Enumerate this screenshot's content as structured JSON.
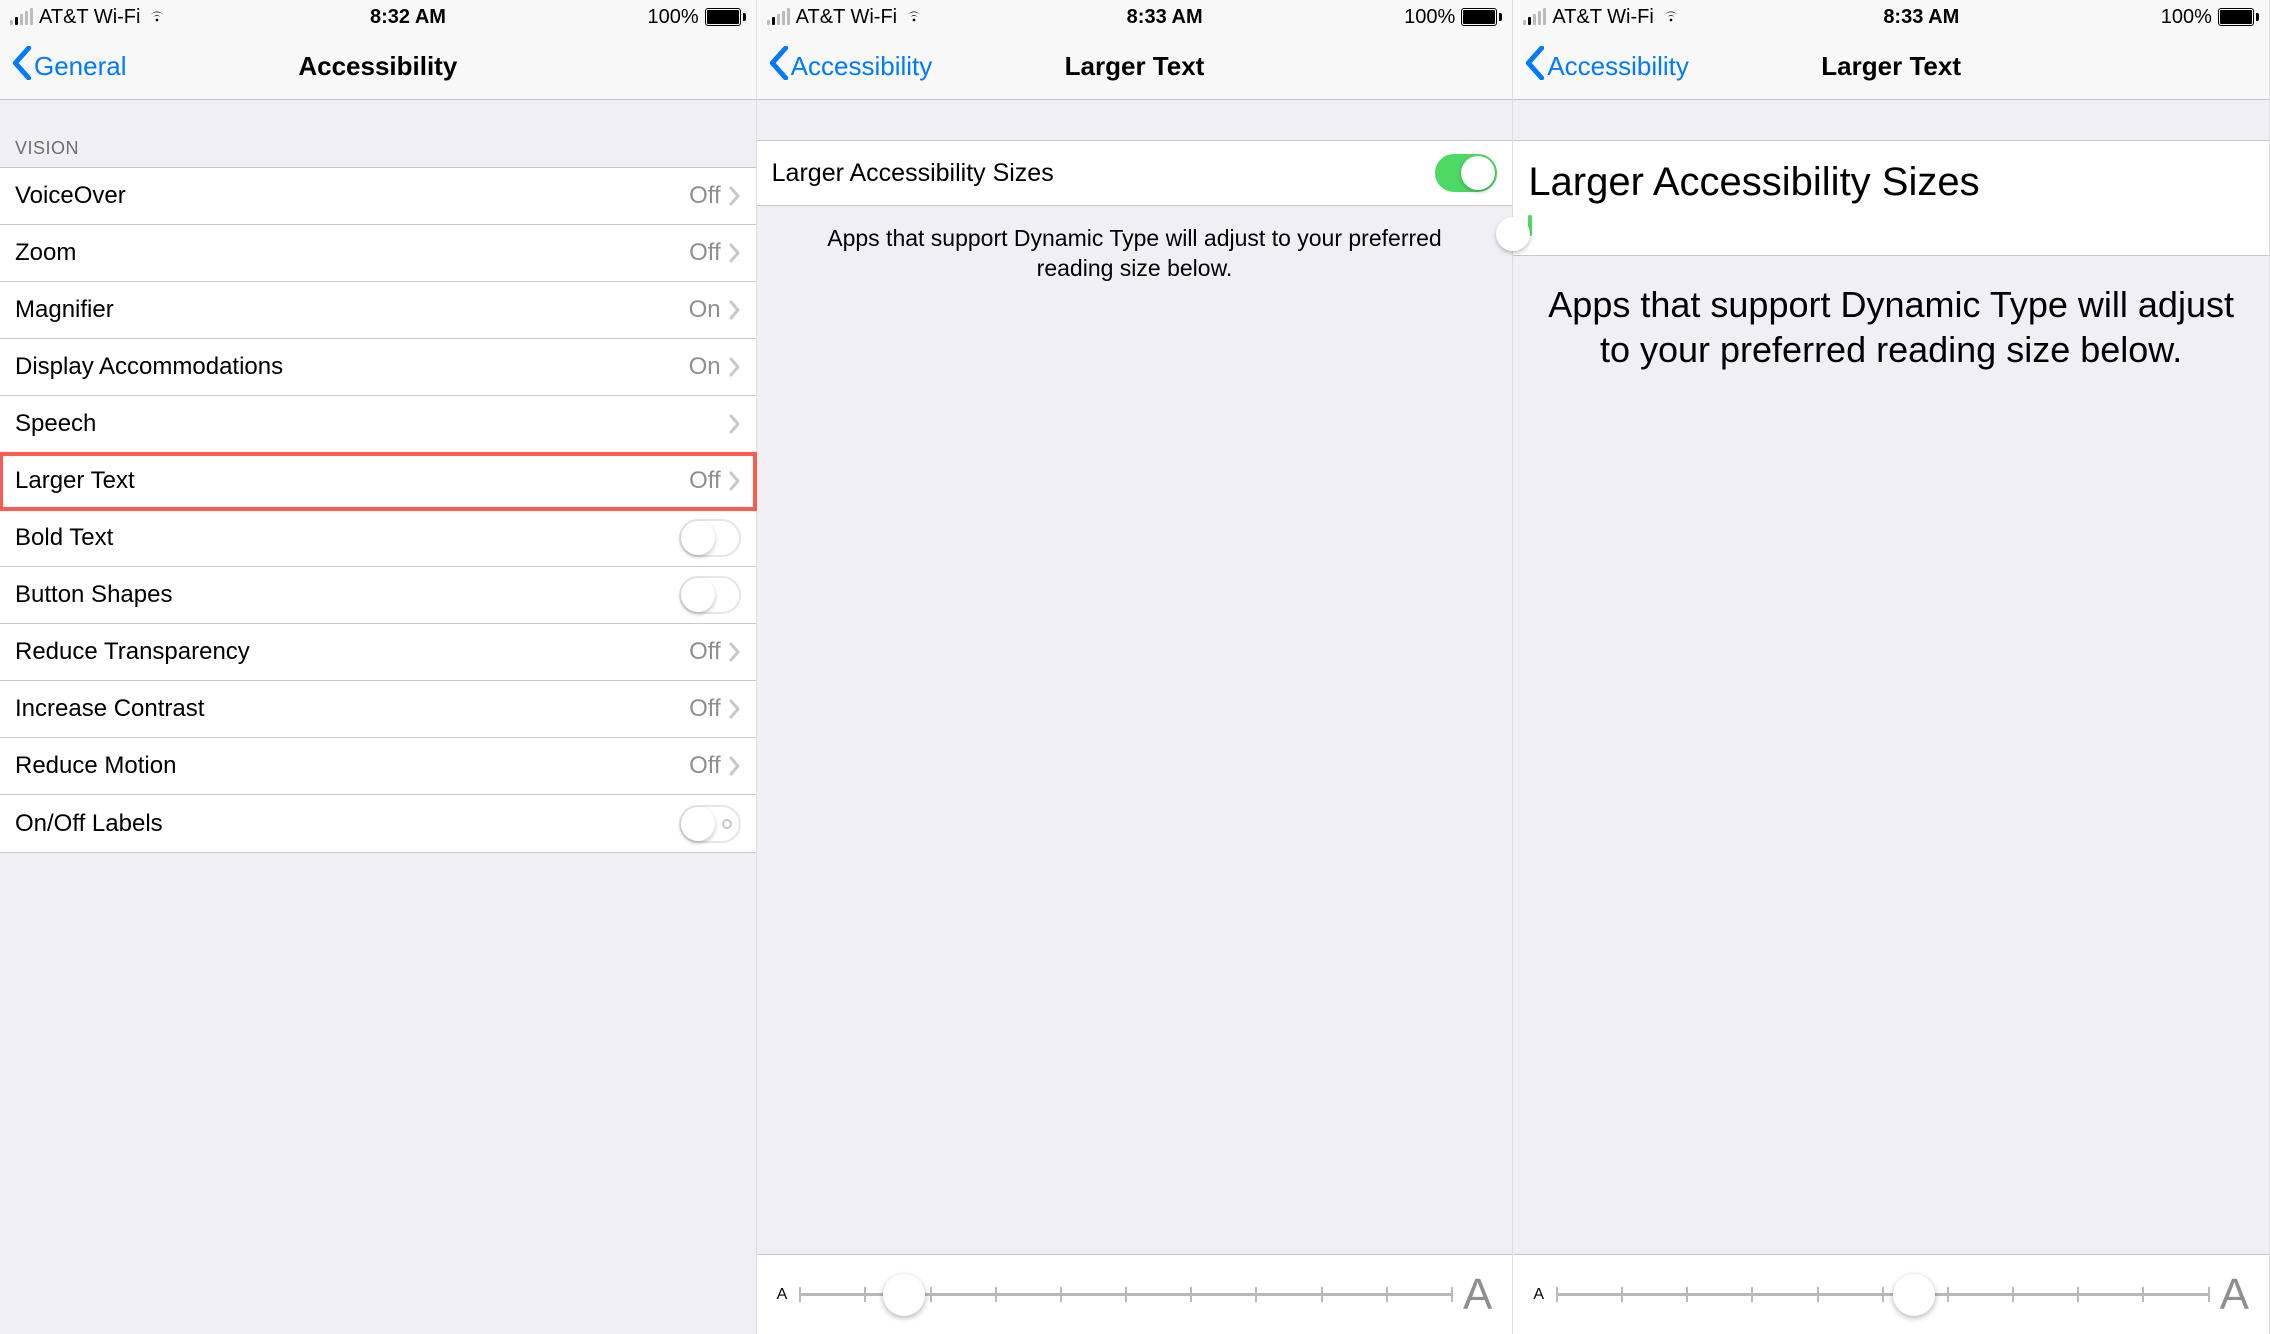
{
  "statusbar": {
    "carrier": "AT&T Wi-Fi",
    "battery": "100%"
  },
  "times": [
    "8:32 AM",
    "8:33 AM",
    "8:33 AM"
  ],
  "screen1": {
    "back": "General",
    "title": "Accessibility",
    "section": "VISION",
    "rows": [
      {
        "label": "VoiceOver",
        "value": "Off",
        "type": "nav"
      },
      {
        "label": "Zoom",
        "value": "Off",
        "type": "nav"
      },
      {
        "label": "Magnifier",
        "value": "On",
        "type": "nav"
      },
      {
        "label": "Display Accommodations",
        "value": "On",
        "type": "nav"
      },
      {
        "label": "Speech",
        "value": "",
        "type": "nav"
      },
      {
        "label": "Larger Text",
        "value": "Off",
        "type": "nav",
        "highlight": true
      },
      {
        "label": "Bold Text",
        "value": "",
        "type": "switch",
        "on": false
      },
      {
        "label": "Button Shapes",
        "value": "",
        "type": "switch",
        "on": false
      },
      {
        "label": "Reduce Transparency",
        "value": "Off",
        "type": "nav"
      },
      {
        "label": "Increase Contrast",
        "value": "Off",
        "type": "nav"
      },
      {
        "label": "Reduce Motion",
        "value": "Off",
        "type": "nav"
      },
      {
        "label": "On/Off Labels",
        "value": "",
        "type": "switch",
        "on": false,
        "onoffdot": true
      }
    ]
  },
  "screen2": {
    "back": "Accessibility",
    "title": "Larger Text",
    "setting_label": "Larger Accessibility Sizes",
    "footer": "Apps that support Dynamic Type will adjust to your preferred reading size below.",
    "slider": {
      "ticks": 11,
      "thumb_percent": 16
    }
  },
  "screen3": {
    "back": "Accessibility",
    "title": "Larger Text",
    "setting_label": "Larger Accessibility Sizes",
    "footer": "Apps that support Dynamic Type will adjust to your preferred reading size below.",
    "slider": {
      "ticks": 11,
      "thumb_percent": 55
    }
  },
  "small_a": "A",
  "big_a": "A"
}
